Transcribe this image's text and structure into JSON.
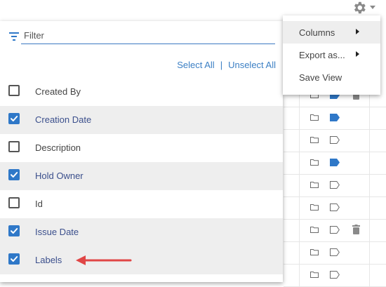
{
  "filter": {
    "placeholder": "Filter"
  },
  "links": {
    "select_all": "Select All",
    "separator": "|",
    "unselect_all": "Unselect All"
  },
  "columns": [
    {
      "label": "Created By",
      "checked": false
    },
    {
      "label": "Creation Date",
      "checked": true
    },
    {
      "label": "Description",
      "checked": false
    },
    {
      "label": "Hold Owner",
      "checked": true
    },
    {
      "label": "Id",
      "checked": false
    },
    {
      "label": "Issue Date",
      "checked": true
    },
    {
      "label": "Labels",
      "checked": true
    }
  ],
  "menu": {
    "items": [
      {
        "label": "Columns",
        "submenu": true
      },
      {
        "label": "Export as...",
        "submenu": true
      },
      {
        "label": "Save View",
        "submenu": false
      }
    ]
  },
  "colors": {
    "accent": "#2f78c8",
    "link": "#3b7fc4",
    "arrow": "#e04646",
    "tag_filled": "#2f78c8"
  },
  "background_rows": [
    {
      "tag": "filled",
      "trash": true
    },
    {
      "tag": "filled",
      "trash": false
    },
    {
      "tag": "outline",
      "trash": false
    },
    {
      "tag": "filled",
      "trash": false
    },
    {
      "tag": "outline",
      "trash": false
    },
    {
      "tag": "outline",
      "trash": false
    },
    {
      "tag": "outline",
      "trash": true
    },
    {
      "tag": "outline",
      "trash": false
    },
    {
      "tag": "outline",
      "trash": false
    }
  ]
}
